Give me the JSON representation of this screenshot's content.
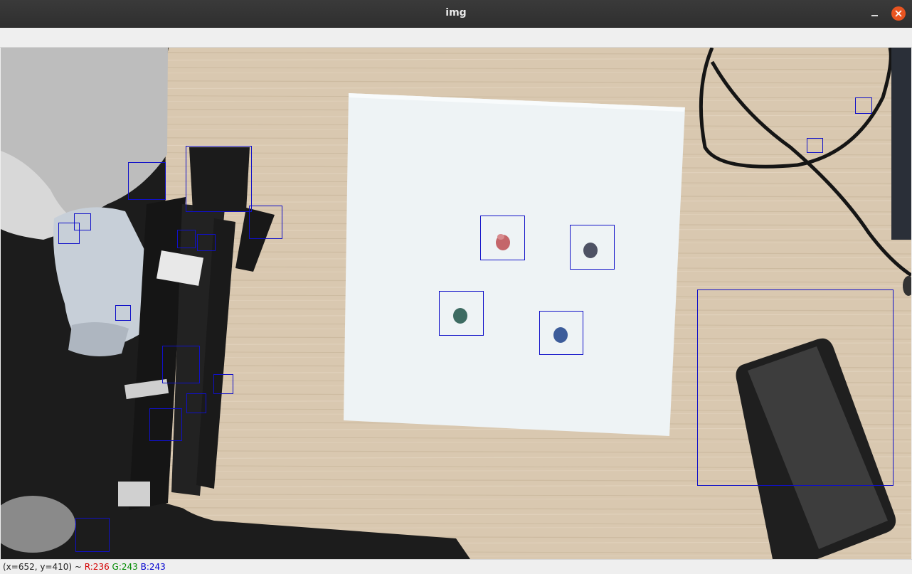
{
  "window": {
    "title": "img"
  },
  "status": {
    "coords": "(x=652, y=410) ~ ",
    "r": "R:236",
    "g": "G:243",
    "b": "B:243"
  },
  "colors": {
    "titlebar": "#2f2f2f",
    "close_button": "#e95420",
    "bbox": "#1010c8",
    "status_r": "#d40000",
    "status_g": "#008a00",
    "status_b": "#0000d0"
  },
  "detections": [
    {
      "name": "detection-box-tripod-1"
    },
    {
      "name": "detection-box-tripod-2"
    },
    {
      "name": "detection-box-tripod-3"
    },
    {
      "name": "detection-box-tripod-4"
    },
    {
      "name": "detection-box-tripod-5"
    },
    {
      "name": "detection-box-tripod-6"
    },
    {
      "name": "detection-box-tripod-7"
    },
    {
      "name": "detection-box-tripod-8"
    },
    {
      "name": "detection-box-tripod-9"
    },
    {
      "name": "detection-box-tripod-10"
    },
    {
      "name": "detection-box-tripod-11"
    },
    {
      "name": "detection-box-tripod-12"
    },
    {
      "name": "detection-box-tripod-13"
    },
    {
      "name": "detection-box-red-marker"
    },
    {
      "name": "detection-box-dark-marker"
    },
    {
      "name": "detection-box-green-marker"
    },
    {
      "name": "detection-box-blue-marker"
    },
    {
      "name": "detection-box-cable-1"
    },
    {
      "name": "detection-box-cable-2"
    },
    {
      "name": "detection-box-phone"
    }
  ]
}
